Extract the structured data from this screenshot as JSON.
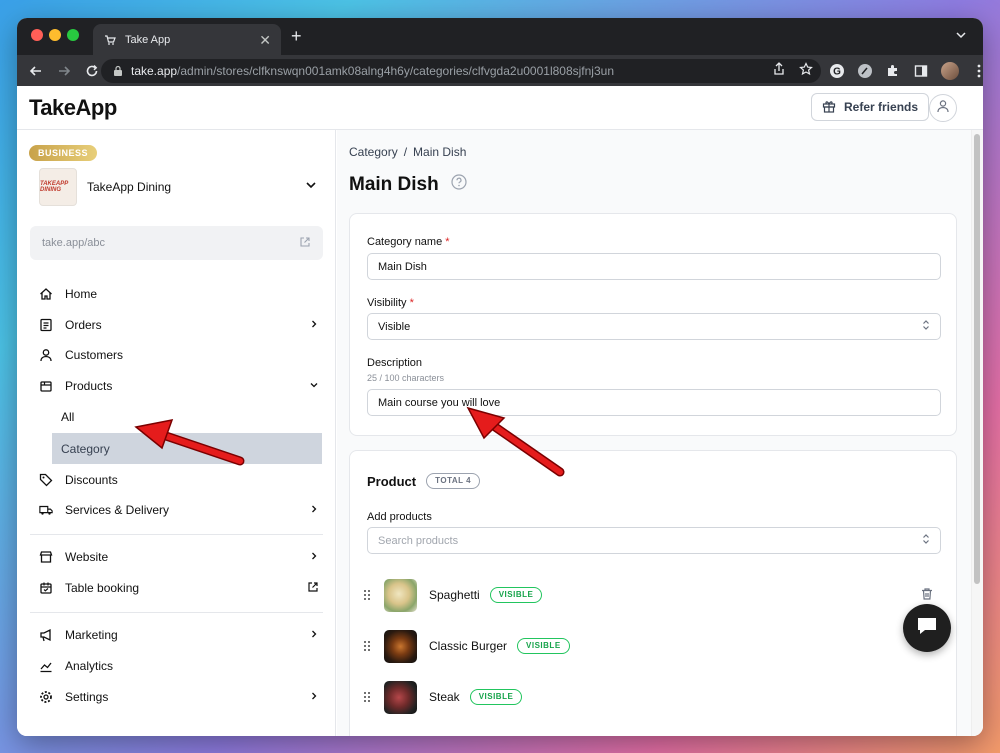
{
  "browser": {
    "tab_title": "Take App",
    "url_host": "take.app",
    "url_path": "/admin/stores/clfknswqn001amk08alng4h6y/categories/clfvgda2u0001l808sjfnj3un"
  },
  "header": {
    "logo": "TakeApp",
    "refer_label": "Refer friends"
  },
  "sidebar": {
    "plan_badge": "BUSINESS",
    "store_name": "TakeApp Dining",
    "store_logo_text": "TAKEAPP DINING",
    "store_url": "take.app/abc",
    "items": [
      {
        "label": "Home",
        "icon": "home-icon"
      },
      {
        "label": "Orders",
        "icon": "orders-icon"
      },
      {
        "label": "Customers",
        "icon": "user-icon"
      },
      {
        "label": "Products",
        "icon": "box-icon"
      },
      {
        "label": "All"
      },
      {
        "label": "Category"
      },
      {
        "label": "Discounts",
        "icon": "tag-icon"
      },
      {
        "label": "Services & Delivery",
        "icon": "truck-icon"
      },
      {
        "label": "Website",
        "icon": "store-icon"
      },
      {
        "label": "Table booking",
        "icon": "calendar-icon"
      },
      {
        "label": "Marketing",
        "icon": "megaphone-icon"
      },
      {
        "label": "Analytics",
        "icon": "chart-icon"
      },
      {
        "label": "Settings",
        "icon": "gear-icon"
      }
    ]
  },
  "main": {
    "breadcrumb": {
      "parent": "Category",
      "separator": "/",
      "current": "Main Dish"
    },
    "title": "Main Dish",
    "form": {
      "category_name_label": "Category name",
      "category_name_value": "Main Dish",
      "visibility_label": "Visibility",
      "visibility_value": "Visible",
      "description_label": "Description",
      "description_hint": "25 / 100 characters",
      "description_value": "Main course you will love",
      "required_mark": "*"
    },
    "products": {
      "title": "Product",
      "total_badge": "TOTAL 4",
      "add_label": "Add products",
      "search_placeholder": "Search products",
      "items": [
        {
          "name": "Spaghetti",
          "status": "VISIBLE"
        },
        {
          "name": "Classic Burger",
          "status": "VISIBLE"
        },
        {
          "name": "Steak",
          "status": "VISIBLE"
        }
      ]
    }
  },
  "colors": {
    "accent_badge": "#16a34a",
    "active_nav_bg": "#cfd5de",
    "required": "#dc2626",
    "arrow": "#e51c1c"
  }
}
